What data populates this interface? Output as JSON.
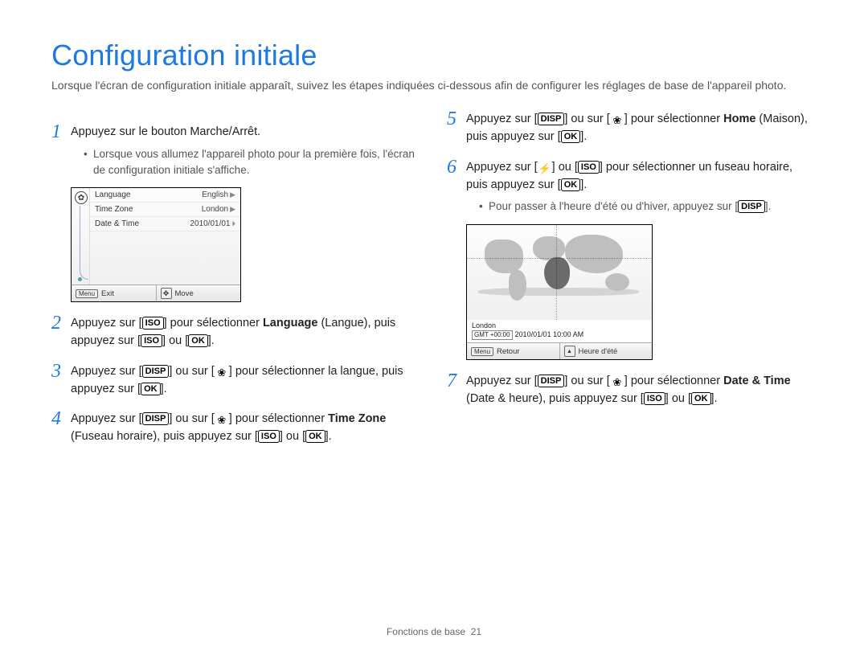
{
  "title": "Configuration initiale",
  "intro": "Lorsque l'écran de configuration initiale apparaît, suivez les étapes indiquées ci-dessous afin de configurer les réglages de base de l'appareil photo.",
  "buttons": {
    "disp": "DISP",
    "iso": "ISO",
    "ok": "OK",
    "menu": "Menu"
  },
  "left_steps": {
    "s1": {
      "num": "1",
      "text": "Appuyez sur le bouton Marche/Arrêt.",
      "sub": "Lorsque vous allumez l'appareil photo pour la première fois, l'écran de configuration initiale s'affiche."
    },
    "s2": {
      "num": "2",
      "pre": "Appuyez sur [",
      "mid1": "] pour sélectionner ",
      "bold1": "Language",
      "mid2": " (Langue), puis appuyez sur [",
      "mid3": "] ou [",
      "post": "]."
    },
    "s3": {
      "num": "3",
      "pre": "Appuyez sur [",
      "mid1": "] ou sur [",
      "mid2": "] pour sélectionner la langue, puis appuyez sur [",
      "post": "]."
    },
    "s4": {
      "num": "4",
      "pre": "Appuyez sur [",
      "mid1": "] ou sur [",
      "mid2": "] pour sélectionner ",
      "bold1": "Time Zone",
      "mid3": " (Fuseau horaire), puis appuyez sur [",
      "mid4": "] ou [",
      "post": "]."
    }
  },
  "right_steps": {
    "s5": {
      "num": "5",
      "pre": "Appuyez sur [",
      "mid1": "] ou sur [",
      "mid2": "] pour sélectionner ",
      "bold1": "Home",
      "mid3": " (Maison), puis appuyez sur [",
      "post": "]."
    },
    "s6": {
      "num": "6",
      "pre": "Appuyez sur [",
      "mid1": "] ou [",
      "mid2": "] pour sélectionner un fuseau horaire, puis appuyez sur [",
      "post": "].",
      "sub_pre": "Pour passer à l'heure d'été ou d'hiver, appuyez sur [",
      "sub_post": "]."
    },
    "s7": {
      "num": "7",
      "pre": "Appuyez sur [",
      "mid1": "] ou sur [",
      "mid2": "] pour sélectionner ",
      "bold1": "Date & Time",
      "mid3": " (Date & heure), puis appuyez sur [",
      "mid4": "] ou [",
      "post": "]."
    }
  },
  "screen1": {
    "rows": [
      {
        "label": "Language",
        "value": "English"
      },
      {
        "label": "Time Zone",
        "value": "London"
      },
      {
        "label": "Date & Time",
        "value": "2010/01/01"
      }
    ],
    "footer_left": "Exit",
    "footer_right": "Move"
  },
  "screen2": {
    "city": "London",
    "gmt_box": "GMT +00:00",
    "datetime": "2010/01/01  10:00 AM",
    "footer_left": "Retour",
    "footer_right": "Heure d'été"
  },
  "footer": {
    "section": "Fonctions de base",
    "page": "21"
  }
}
